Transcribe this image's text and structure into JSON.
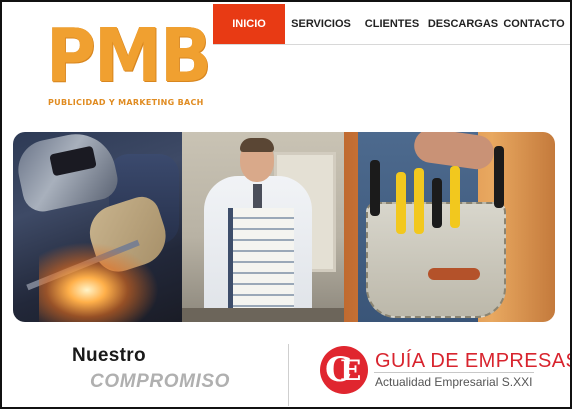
{
  "logo": {
    "main": "PMB",
    "tagline": "PUBLICIDAD Y MARKETING BACH",
    "color": "#f0a030"
  },
  "nav": {
    "items": [
      {
        "label": "INICIO",
        "active": true
      },
      {
        "label": "SERVICIOS",
        "active": false
      },
      {
        "label": "CLIENTES",
        "active": false
      },
      {
        "label": "DESCARGAS",
        "active": false
      },
      {
        "label": "CONTACTO",
        "active": false
      }
    ],
    "active_color": "#e83a14"
  },
  "banner": {
    "panels": [
      "welder",
      "businessman-with-binders",
      "tool-belt"
    ]
  },
  "compromiso": {
    "line1": "Nuestro",
    "line2": "COMPROMISO"
  },
  "guia": {
    "logo_letters": "GE",
    "title": "GUÍA DE EMPRESAS",
    "subtitle": "Actualidad Empresarial S.XXI",
    "brand_color": "#d8242e"
  }
}
